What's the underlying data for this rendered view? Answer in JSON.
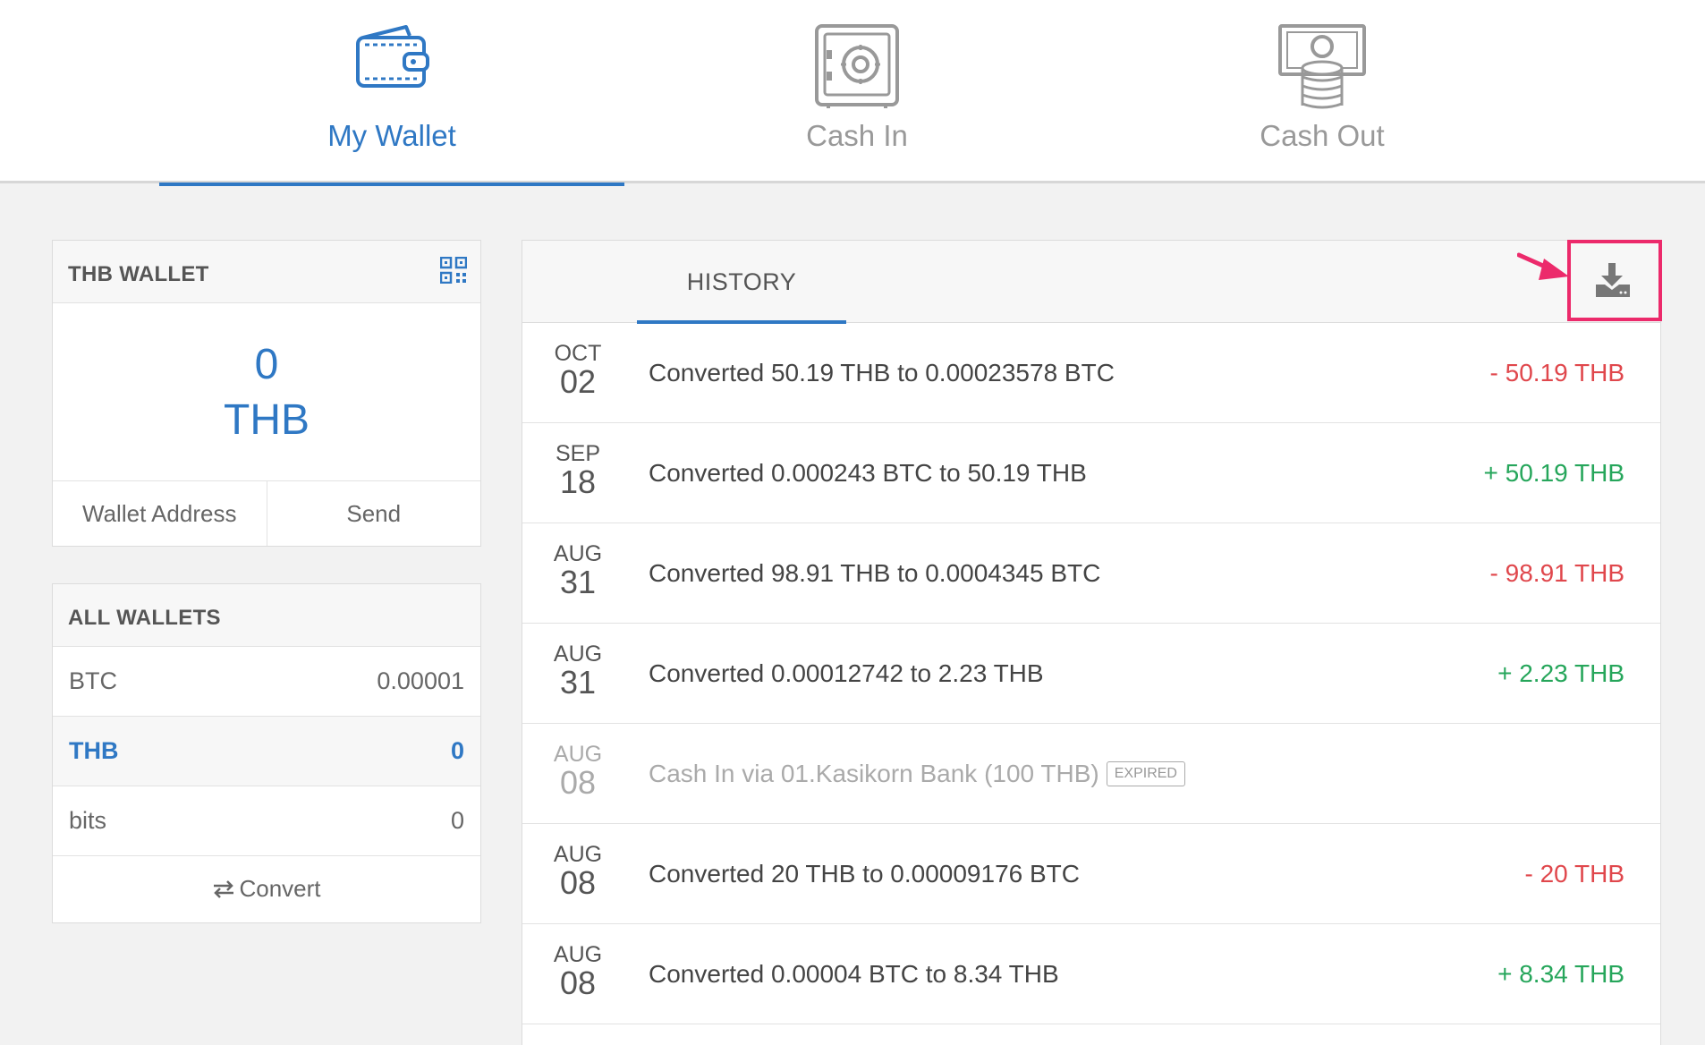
{
  "nav": {
    "tabs": [
      {
        "label": "My Wallet",
        "icon": "wallet-icon",
        "active": true
      },
      {
        "label": "Cash In",
        "icon": "safe-icon",
        "active": false
      },
      {
        "label": "Cash Out",
        "icon": "cash-coins-icon",
        "active": false
      }
    ]
  },
  "thb_wallet": {
    "title": "THB WALLET",
    "balance": "0",
    "currency": "THB",
    "wallet_address_label": "Wallet Address",
    "send_label": "Send"
  },
  "all_wallets": {
    "title": "ALL WALLETS",
    "items": [
      {
        "currency": "BTC",
        "amount": "0.00001"
      },
      {
        "currency": "THB",
        "amount": "0"
      },
      {
        "currency": "bits",
        "amount": "0"
      }
    ],
    "convert_label": "Convert"
  },
  "history": {
    "tab_label": "HISTORY",
    "rows": [
      {
        "month": "OCT",
        "day": "02",
        "description": "Converted 50.19 THB to 0.00023578 BTC",
        "amount": "- 50.19 THB"
      },
      {
        "month": "SEP",
        "day": "18",
        "description": "Converted 0.000243 BTC to 50.19 THB",
        "amount": "+ 50.19 THB"
      },
      {
        "month": "AUG",
        "day": "31",
        "description": "Converted 98.91 THB to 0.0004345 BTC",
        "amount": "- 98.91 THB"
      },
      {
        "month": "AUG",
        "day": "31",
        "description": "Converted 0.00012742 to 2.23 THB",
        "amount": "+ 2.23 THB"
      },
      {
        "month": "AUG",
        "day": "08",
        "description": "Cash In via 01.Kasikorn Bank (100 THB)",
        "badge": "EXPIRED",
        "amount": ""
      },
      {
        "month": "AUG",
        "day": "08",
        "description": "Converted 20 THB to 0.00009176 BTC",
        "amount": "- 20 THB"
      },
      {
        "month": "AUG",
        "day": "08",
        "description": "Converted 0.00004 BTC to 8.34 THB",
        "amount": "+ 8.34 THB"
      }
    ]
  },
  "colors": {
    "accent": "#2f78c4",
    "negative": "#e0474c",
    "positive": "#26a65b",
    "highlight": "#ec2a6b"
  }
}
